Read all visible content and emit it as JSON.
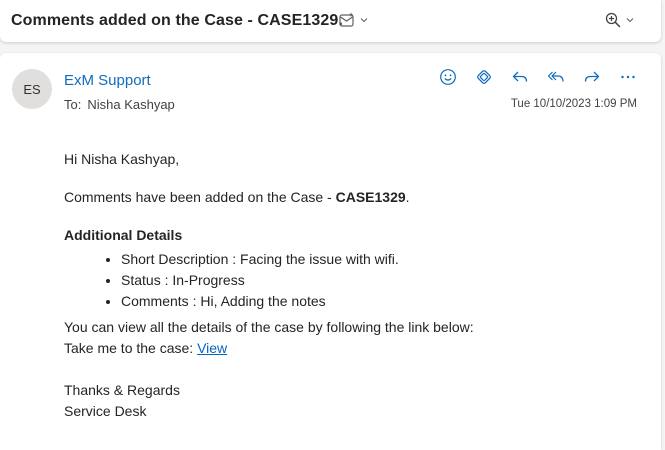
{
  "subject": "Comments added on the Case - CASE1329.",
  "sender": {
    "initials": "ES",
    "name": "ExM Support",
    "to_label": "To:",
    "to_name": "Nisha Kashyap",
    "date": "Tue 10/10/2023 1:09 PM"
  },
  "icons": {
    "subject_action": "summary-icon",
    "zoom": "zoom-in-icon",
    "actions": [
      "emoji-icon",
      "loop-icon",
      "reply-icon",
      "reply-all-icon",
      "forward-icon",
      "more-icon"
    ]
  },
  "colors": {
    "accent": "#0f6cbd",
    "link": "#0563c1",
    "avatar_bg": "#e1dfdd"
  },
  "body": {
    "greeting": "Hi Nisha Kashyap,",
    "case_line_prefix": "Comments have been added on the Case - ",
    "case_id": "CASE1329",
    "case_line_suffix": ".",
    "details_heading": "Additional Details",
    "details": [
      "Short Description : Facing the issue with wifi.",
      "Status : In-Progress",
      "Comments : Hi, Adding the notes"
    ],
    "view_line": "You can view all the details of the case by following the link below:",
    "take_me_prefix": "Take me to the case: ",
    "view_link": "View",
    "regards": "Thanks & Regards",
    "signature": "Service Desk"
  }
}
